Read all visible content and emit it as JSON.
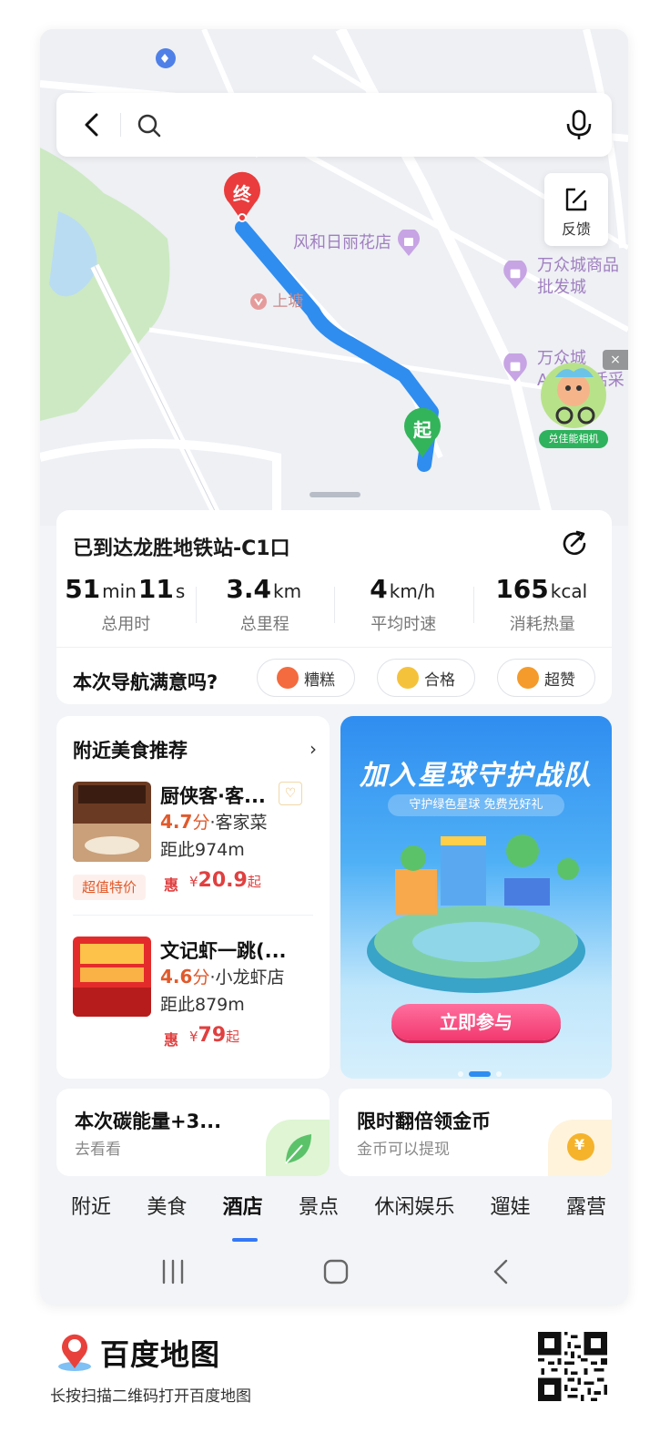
{
  "search": {
    "placeholder": ""
  },
  "map": {
    "feedback_label": "反馈",
    "poi_1": "风和日丽花店",
    "poi_2_line1": "万众城商品",
    "poi_2_line2": "批发城",
    "poi_3_line1": "万众城",
    "poi_3_line2": "A1区生活采",
    "metro": "上塘",
    "end_pin": "终",
    "start_pin": "起",
    "ad_badge": "兑佳能相机",
    "ad_close": "×"
  },
  "summary": {
    "title": "已到达龙胜地铁站-C1口",
    "stats": [
      {
        "v1": "51",
        "u1": "min",
        "v2": "11",
        "u2": "s",
        "label": "总用时"
      },
      {
        "v1": "3.4",
        "u1": "km",
        "label": "总里程"
      },
      {
        "v1": "4",
        "u1": "km/h",
        "label": "平均时速"
      },
      {
        "v1": "165",
        "u1": "kcal",
        "label": "消耗热量"
      }
    ],
    "rating_question": "本次导航满意吗?",
    "rating_options": [
      "糟糕",
      "合格",
      "超赞"
    ]
  },
  "food": {
    "title": "附近美食推荐",
    "chevron": "›",
    "items": [
      {
        "name": "厨侠客·客...",
        "score": "4.7",
        "score_unit": "分",
        "category": "·客家菜",
        "distance": "距此974m",
        "promo": "超值特价",
        "hui": "惠",
        "currency": "¥",
        "price": "20.9",
        "price_suffix": "起",
        "thumb_text": "厨侠客"
      },
      {
        "name": "文记虾一跳(...",
        "score": "4.6",
        "score_unit": "分",
        "category": "·小龙虾店",
        "distance": "距此879m",
        "hui": "惠",
        "currency": "¥",
        "price": "79",
        "price_suffix": "起",
        "thumb_text": "文记虾一跳"
      }
    ]
  },
  "banner": {
    "title": "加入星球守护战队",
    "subtitle": "守护绿色星球 免费兑好礼",
    "button": "立即参与"
  },
  "cards": {
    "carbon_title": "本次碳能量+3...",
    "carbon_sub": "去看看",
    "coin_title": "限时翻倍领金币",
    "coin_sub": "金币可以提现",
    "coin_symbol": "¥"
  },
  "tabs": [
    "附近",
    "美食",
    "酒店",
    "景点",
    "休闲娱乐",
    "遛娃",
    "露营"
  ],
  "active_tab": "酒店",
  "footer": {
    "brand": "百度地图",
    "hint": "长按扫描二维码打开百度地图"
  },
  "colors": {
    "route": "#2f8df0",
    "end_pin": "#ea3c3c",
    "start_pin": "#34b45a",
    "accent": "#3478f6",
    "price": "#e04040"
  }
}
